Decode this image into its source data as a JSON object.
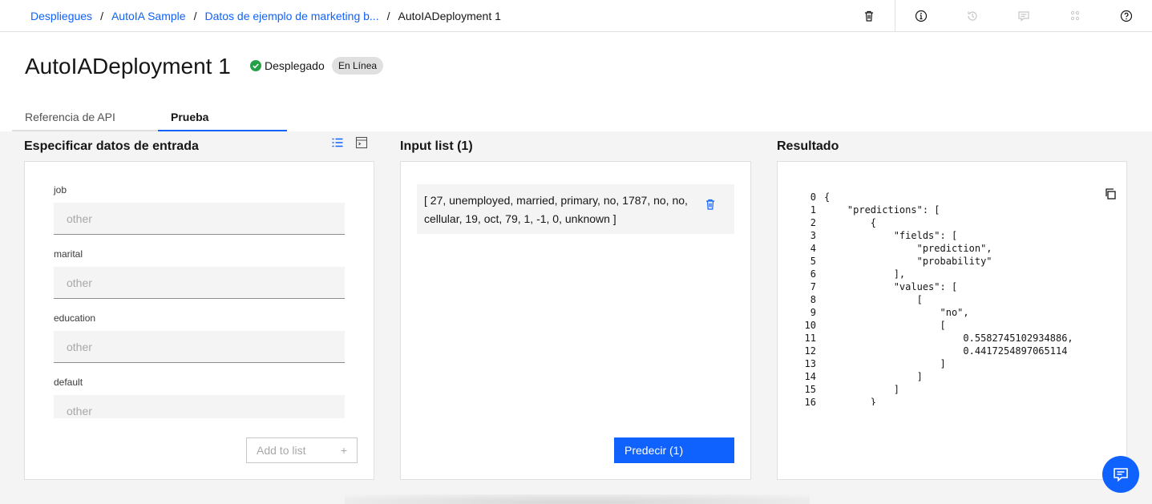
{
  "breadcrumb": {
    "items": [
      "Despliegues",
      "AutoIA Sample",
      "Datos de ejemplo de marketing b..."
    ],
    "separator": "/",
    "current": "AutoIADeployment 1"
  },
  "toolbar": {
    "icons": [
      "trash-icon",
      "info-icon",
      "history-icon",
      "comment-icon",
      "apps-icon",
      "help-icon"
    ]
  },
  "header": {
    "title": "AutoIADeployment 1",
    "status": "Desplegado",
    "badge": "En Línea",
    "status_color": "#24a148"
  },
  "tabs": [
    {
      "label": "Referencia de API",
      "active": false
    },
    {
      "label": "Prueba",
      "active": true
    }
  ],
  "input_panel": {
    "title": "Especificar datos de entrada",
    "fields": [
      {
        "label": "job",
        "placeholder": "other"
      },
      {
        "label": "marital",
        "placeholder": "other"
      },
      {
        "label": "education",
        "placeholder": "other"
      },
      {
        "label": "default",
        "placeholder": "other"
      }
    ],
    "add_button": "Add to list",
    "add_symbol": "+"
  },
  "list_panel": {
    "title": "Input list (1)",
    "items": [
      "[ 27, unemployed, married, primary, no, 1787, no, no, cellular, 19, oct, 79, 1, -1, 0, unknown ]"
    ],
    "predict_button": "Predecir (1)"
  },
  "result_panel": {
    "title": "Resultado",
    "lines": [
      {
        "n": "0",
        "t": "{"
      },
      {
        "n": "1",
        "t": "    \"predictions\": ["
      },
      {
        "n": "2",
        "t": "        {"
      },
      {
        "n": "3",
        "t": "            \"fields\": ["
      },
      {
        "n": "4",
        "t": "                \"prediction\","
      },
      {
        "n": "5",
        "t": "                \"probability\""
      },
      {
        "n": "6",
        "t": "            ],"
      },
      {
        "n": "7",
        "t": "            \"values\": ["
      },
      {
        "n": "8",
        "t": "                ["
      },
      {
        "n": "9",
        "t": "                    \"no\","
      },
      {
        "n": "10",
        "t": "                    ["
      },
      {
        "n": "11",
        "t": "                        0.5582745102934886,"
      },
      {
        "n": "12",
        "t": "                        0.4417254897065114"
      },
      {
        "n": "13",
        "t": "                    ]"
      },
      {
        "n": "14",
        "t": "                ]"
      },
      {
        "n": "15",
        "t": "            ]"
      },
      {
        "n": "16",
        "t": "        }"
      }
    ]
  },
  "colors": {
    "accent": "#0f62fe",
    "success": "#24a148"
  }
}
